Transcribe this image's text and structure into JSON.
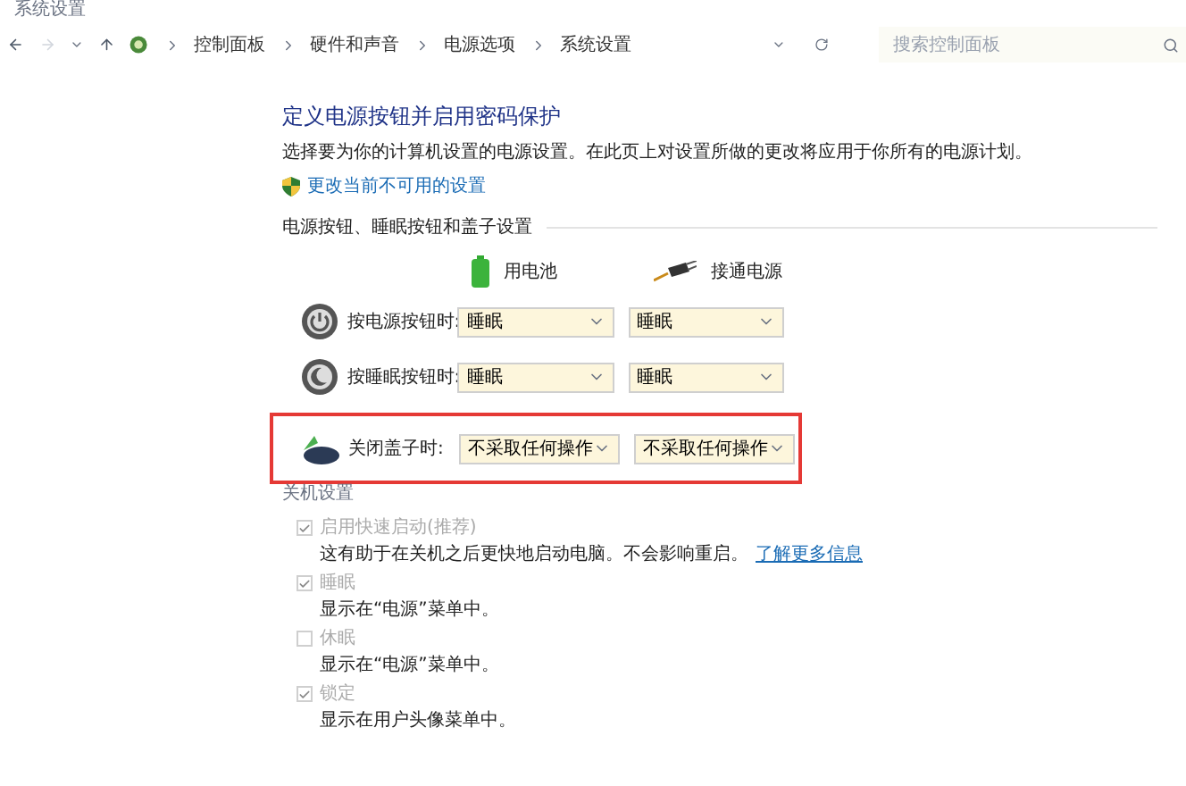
{
  "window": {
    "title": "系统设置"
  },
  "breadcrumb": [
    "控制面板",
    "硬件和声音",
    "电源选项",
    "系统设置"
  ],
  "search": {
    "placeholder": "搜索控制面板"
  },
  "heading": "定义电源按钮并启用密码保护",
  "description": "选择要为你的计算机设置的电源设置。在此页上对设置所做的更改将应用于你所有的电源计划。",
  "admin_link": "更改当前不可用的设置",
  "buttons_section": {
    "title": "电源按钮、睡眠按钮和盖子设置",
    "columns": [
      "用电池",
      "接通电源"
    ],
    "rows": [
      {
        "kind": "power",
        "label": "按电源按钮时:",
        "battery": "睡眠",
        "plugged": "睡眠",
        "highlighted": false
      },
      {
        "kind": "sleep",
        "label": "按睡眠按钮时:",
        "battery": "睡眠",
        "plugged": "睡眠",
        "highlighted": false
      },
      {
        "kind": "lid",
        "label": "关闭盖子时:",
        "battery": "不采取任何操作",
        "plugged": "不采取任何操作",
        "highlighted": true
      }
    ]
  },
  "shutdown_section": {
    "title": "关机设置",
    "options": [
      {
        "label": "启用快速启动(推荐)",
        "checked": true,
        "disabled": true,
        "description": "这有助于在关机之后更快地启动电脑。不会影响重启。",
        "link": "了解更多信息"
      },
      {
        "label": "睡眠",
        "checked": true,
        "disabled": true,
        "description": "显示在“电源”菜单中。"
      },
      {
        "label": "休眠",
        "checked": false,
        "disabled": true,
        "description": "显示在“电源”菜单中。"
      },
      {
        "label": "锁定",
        "checked": true,
        "disabled": true,
        "description": "显示在用户头像菜单中。"
      }
    ]
  }
}
